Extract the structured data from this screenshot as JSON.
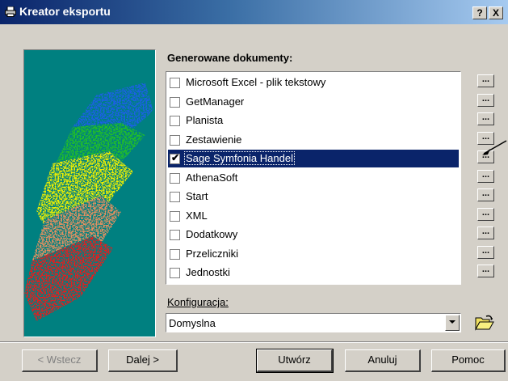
{
  "window": {
    "title": "Kreator eksportu",
    "help_button": "?",
    "close_button": "X"
  },
  "documents": {
    "heading": "Generowane dokumenty:",
    "items": [
      {
        "label": "Microsoft Excel - plik tekstowy",
        "checked": false
      },
      {
        "label": "GetManager",
        "checked": false
      },
      {
        "label": "Planista",
        "checked": false
      },
      {
        "label": "Zestawienie",
        "checked": false
      },
      {
        "label": "Sage Symfonia Handel",
        "checked": true,
        "selected": true
      },
      {
        "label": "AthenaSoft",
        "checked": false
      },
      {
        "label": "Start",
        "checked": false
      },
      {
        "label": "XML",
        "checked": false
      },
      {
        "label": "Dodatkowy",
        "checked": false
      },
      {
        "label": "Przeliczniki",
        "checked": false
      },
      {
        "label": "Jednostki",
        "checked": false
      }
    ],
    "options_button_label": "...",
    "check_mark": "✔"
  },
  "config": {
    "label": "Konfiguracja:",
    "value": "Domyslna"
  },
  "buttons": {
    "back": "< Wstecz",
    "next": "Dalej >",
    "create": "Utwórz",
    "cancel": "Anuluj",
    "help": "Pomoc"
  },
  "colors": {
    "title_start": "#0a246a",
    "title_end": "#a6caf0",
    "selection": "#0a246a",
    "panel": "#008080"
  }
}
